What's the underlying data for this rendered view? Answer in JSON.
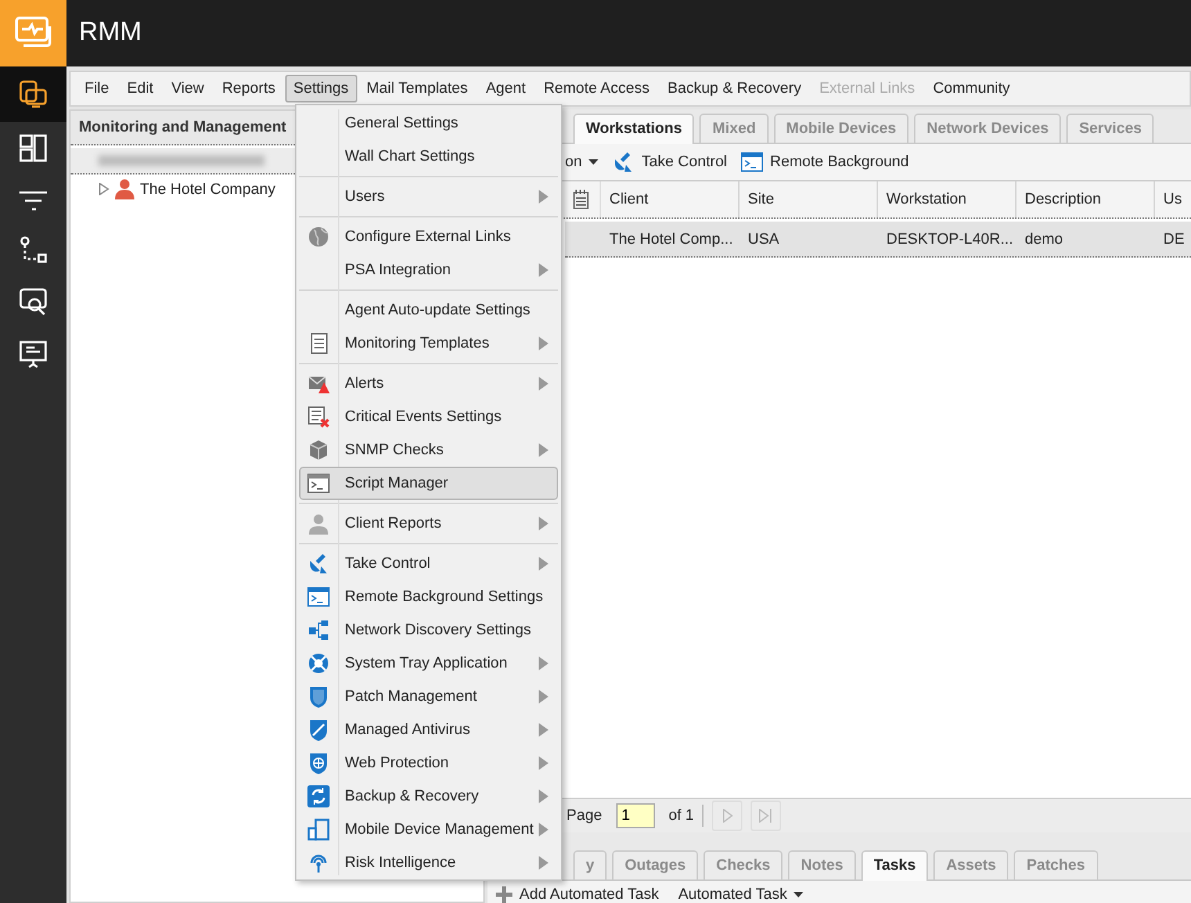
{
  "app": {
    "title": "RMM"
  },
  "sidebar": [
    {
      "selected": true
    },
    {
      "selected": false
    },
    {
      "selected": false
    },
    {
      "selected": false
    },
    {
      "selected": false
    },
    {
      "selected": false
    }
  ],
  "menubar": [
    {
      "label": "File",
      "selected": false,
      "disabled": false
    },
    {
      "label": "Edit",
      "selected": false,
      "disabled": false
    },
    {
      "label": "View",
      "selected": false,
      "disabled": false
    },
    {
      "label": "Reports",
      "selected": false,
      "disabled": false
    },
    {
      "label": "Settings",
      "selected": true,
      "disabled": false
    },
    {
      "label": "Mail Templates",
      "selected": false,
      "disabled": false
    },
    {
      "label": "Agent",
      "selected": false,
      "disabled": false
    },
    {
      "label": "Remote Access",
      "selected": false,
      "disabled": false
    },
    {
      "label": "Backup & Recovery",
      "selected": false,
      "disabled": false
    },
    {
      "label": "External Links",
      "selected": false,
      "disabled": true
    },
    {
      "label": "Community",
      "selected": false,
      "disabled": false
    }
  ],
  "left_panel": {
    "title": "Monitoring and Management",
    "tree": [
      {
        "label": "The Hotel Company",
        "expanded": false
      }
    ]
  },
  "device_tabs": [
    {
      "label": "Workstations",
      "selected": true
    },
    {
      "label": "Mixed",
      "selected": false
    },
    {
      "label": "Mobile Devices",
      "selected": false
    },
    {
      "label": "Network Devices",
      "selected": false
    },
    {
      "label": "Services",
      "selected": false
    }
  ],
  "toolbar": [
    {
      "kind": "dropdown",
      "label": "on"
    },
    {
      "kind": "take-control",
      "label": "Take Control"
    },
    {
      "kind": "remote-background",
      "label": "Remote Background"
    }
  ],
  "table": {
    "columns": [
      "Client",
      "Site",
      "Workstation",
      "Description",
      "Us"
    ],
    "rows": [
      {
        "cells": [
          "The Hotel Comp...",
          "USA",
          "DESKTOP-L40R...",
          "demo",
          "DE"
        ],
        "selected": true
      }
    ]
  },
  "pager": {
    "label": "Page",
    "value": "1",
    "total": "of 1"
  },
  "detail_tabs": [
    {
      "label": "y",
      "selected": false
    },
    {
      "label": "Outages",
      "selected": false
    },
    {
      "label": "Checks",
      "selected": false
    },
    {
      "label": "Notes",
      "selected": false
    },
    {
      "label": "Tasks",
      "selected": true
    },
    {
      "label": "Assets",
      "selected": false
    },
    {
      "label": "Patches",
      "selected": false
    }
  ],
  "detail_toolbar": [
    {
      "kind": "add",
      "label": "Add Automated Task"
    },
    {
      "kind": "dropdown",
      "label": "Automated Task"
    }
  ],
  "settings_menu": {
    "groups": [
      {
        "items": [
          {
            "label": "General Settings",
            "submenu": false,
            "selected": false
          },
          {
            "label": "Wall Chart Settings",
            "submenu": false,
            "selected": false
          }
        ]
      },
      {
        "items": [
          {
            "label": "Users",
            "submenu": true,
            "selected": false
          }
        ]
      },
      {
        "items": [
          {
            "label": "Configure External Links",
            "submenu": false,
            "selected": false
          },
          {
            "label": "PSA Integration",
            "submenu": true,
            "selected": false
          }
        ]
      },
      {
        "items": [
          {
            "label": "Agent Auto-update Settings",
            "submenu": false,
            "selected": false
          },
          {
            "label": "Monitoring Templates",
            "submenu": true,
            "selected": false
          }
        ]
      },
      {
        "items": [
          {
            "label": "Alerts",
            "submenu": true,
            "selected": false
          },
          {
            "label": "Critical Events Settings",
            "submenu": false,
            "selected": false
          },
          {
            "label": "SNMP Checks",
            "submenu": true,
            "selected": false
          },
          {
            "label": "Script Manager",
            "submenu": false,
            "selected": true
          }
        ]
      },
      {
        "items": [
          {
            "label": "Client Reports",
            "submenu": true,
            "selected": false
          }
        ]
      },
      {
        "items": [
          {
            "label": "Take Control",
            "submenu": true,
            "selected": false
          },
          {
            "label": "Remote Background Settings",
            "submenu": false,
            "selected": false
          },
          {
            "label": "Network Discovery Settings",
            "submenu": false,
            "selected": false
          },
          {
            "label": "System Tray Application",
            "submenu": true,
            "selected": false
          },
          {
            "label": "Patch Management",
            "submenu": true,
            "selected": false
          },
          {
            "label": "Managed Antivirus",
            "submenu": true,
            "selected": false
          },
          {
            "label": "Web Protection",
            "submenu": true,
            "selected": false
          },
          {
            "label": "Backup & Recovery",
            "submenu": true,
            "selected": false
          },
          {
            "label": "Mobile Device Management",
            "submenu": true,
            "selected": false
          },
          {
            "label": "Risk Intelligence",
            "submenu": true,
            "selected": false
          }
        ]
      }
    ]
  }
}
